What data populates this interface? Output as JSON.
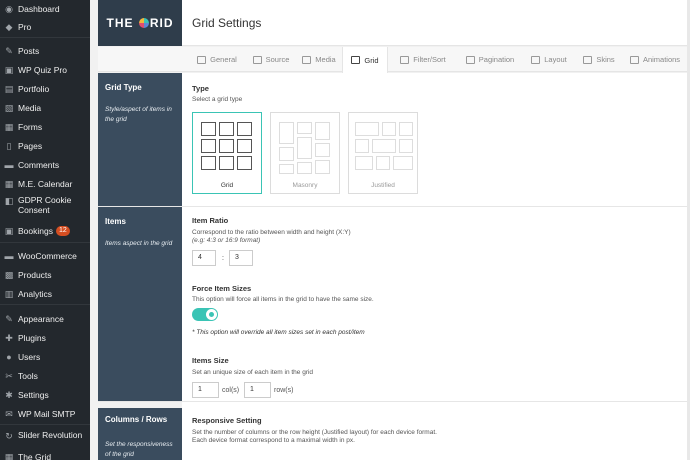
{
  "wp_sidebar": {
    "items": [
      {
        "label": "Dashboard",
        "icon": "dashboard-icon",
        "glyph": "◉"
      },
      {
        "label": "Pro",
        "icon": "pro-icon",
        "glyph": "◆"
      },
      {
        "label": "Posts",
        "icon": "pin-icon",
        "glyph": "✎"
      },
      {
        "label": "WP Quiz Pro",
        "icon": "quiz-icon",
        "glyph": "▣"
      },
      {
        "label": "Portfolio",
        "icon": "portfolio-icon",
        "glyph": "▤"
      },
      {
        "label": "Media",
        "icon": "media-icon",
        "glyph": "▧"
      },
      {
        "label": "Forms",
        "icon": "forms-icon",
        "glyph": "▦"
      },
      {
        "label": "Pages",
        "icon": "pages-icon",
        "glyph": "▯"
      },
      {
        "label": "Comments",
        "icon": "comments-icon",
        "glyph": "▬"
      },
      {
        "label": "M.E. Calendar",
        "icon": "calendar-icon",
        "glyph": "▦"
      },
      {
        "label": "GDPR Cookie Consent",
        "icon": "gdpr-icon",
        "glyph": "◧"
      },
      {
        "label": "Bookings",
        "icon": "bookings-icon",
        "glyph": "▣",
        "badge": "12"
      },
      {
        "label": "WooCommerce",
        "icon": "woocommerce-icon",
        "glyph": "▬"
      },
      {
        "label": "Products",
        "icon": "products-icon",
        "glyph": "▩"
      },
      {
        "label": "Analytics",
        "icon": "analytics-icon",
        "glyph": "▥"
      },
      {
        "label": "Appearance",
        "icon": "appearance-icon",
        "glyph": "✎"
      },
      {
        "label": "Plugins",
        "icon": "plugins-icon",
        "glyph": "✚"
      },
      {
        "label": "Users",
        "icon": "users-icon",
        "glyph": "●"
      },
      {
        "label": "Tools",
        "icon": "tools-icon",
        "glyph": "✂"
      },
      {
        "label": "Settings",
        "icon": "settings-icon",
        "glyph": "✱"
      },
      {
        "label": "WP Mail SMTP",
        "icon": "mail-icon",
        "glyph": "✉"
      },
      {
        "label": "Slider Revolution",
        "icon": "slider-icon",
        "glyph": "↻"
      },
      {
        "label": "The Grid",
        "icon": "grid-icon",
        "glyph": "▦"
      }
    ]
  },
  "header": {
    "logo_left": "THE",
    "logo_right": "RID",
    "title": "Grid Settings"
  },
  "tabs": [
    {
      "label": "General",
      "icon": "gear-icon"
    },
    {
      "label": "Source",
      "icon": "folder-icon"
    },
    {
      "label": "Media",
      "icon": "image-icon"
    },
    {
      "label": "Grid",
      "icon": "grid-icon",
      "active": true
    },
    {
      "label": "Filter/Sort",
      "icon": "filter-icon"
    },
    {
      "label": "Pagination",
      "icon": "pagination-icon"
    },
    {
      "label": "Layout",
      "icon": "layout-icon"
    },
    {
      "label": "Skins",
      "icon": "palette-icon"
    },
    {
      "label": "Animations",
      "icon": "animations-icon"
    }
  ],
  "sections": {
    "grid_type": {
      "title": "Grid Type",
      "desc": "Style/aspect of items in the grid",
      "label": "Type",
      "sublabel": "Select a grid type",
      "options": [
        "Grid",
        "Masonry",
        "Justified"
      ],
      "selected": "Grid"
    },
    "items": {
      "title": "Items",
      "desc": "Items aspect in the grid",
      "ratio_label": "Item Ratio",
      "ratio_desc": "Correspond to the ratio between width and height (X:Y)",
      "ratio_example": "(e.g: 4:3 or 16:9 format)",
      "ratio_x": "4",
      "ratio_sep": ":",
      "ratio_y": "3",
      "force_label": "Force Item Sizes",
      "force_desc": "This option will force all items in the grid to have the same size.",
      "force_on": true,
      "force_note": "* This option will override all item sizes set in each post/item",
      "size_label": "Items Size",
      "size_desc": "Set an unique size of each item in the grid",
      "cols_value": "1",
      "cols_unit": "col(s)",
      "rows_value": "1",
      "rows_unit": "row(s)"
    },
    "columns_rows": {
      "title": "Columns / Rows",
      "desc": "Set the responsiveness of the grid",
      "label": "Responsive Setting",
      "desc_line1": "Set the number of columns or the row height (Justified layout) for each device format.",
      "desc_line2": "Each device format correspond to a maximal width in px."
    }
  },
  "colors": {
    "accent": "#3ac4b5",
    "sidebar_bg": "#23282d",
    "section_bg": "#3a4c5e",
    "badge": "#d54e21"
  }
}
